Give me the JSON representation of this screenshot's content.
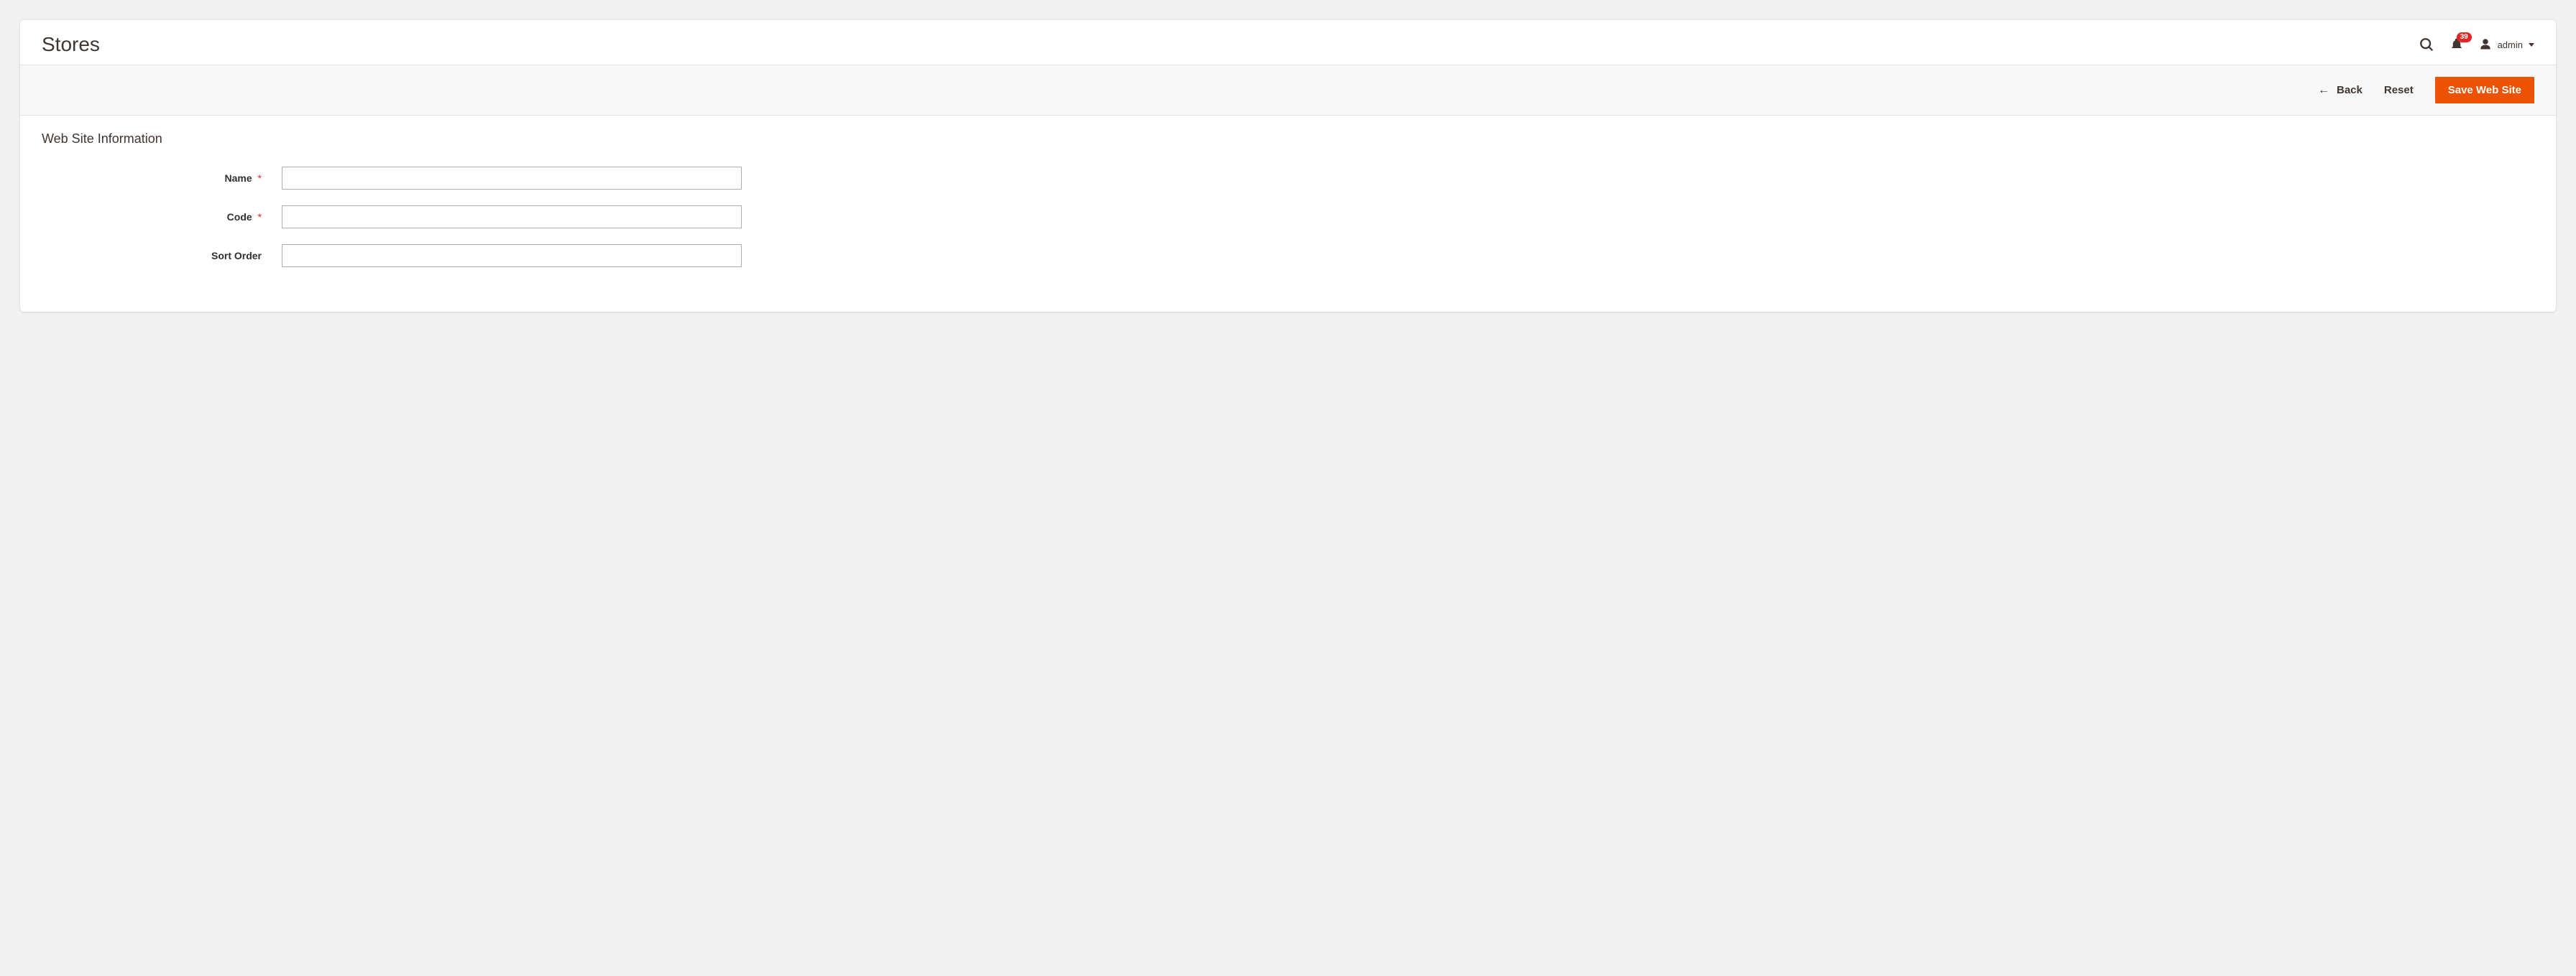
{
  "header": {
    "title": "Stores",
    "notification_count": "39",
    "user_name": "admin"
  },
  "actions": {
    "back": "Back",
    "reset": "Reset",
    "save": "Save Web Site"
  },
  "form": {
    "section_title": "Web Site Information",
    "fields": {
      "name": {
        "label": "Name",
        "required": true,
        "value": ""
      },
      "code": {
        "label": "Code",
        "required": true,
        "value": ""
      },
      "sort_order": {
        "label": "Sort Order",
        "required": false,
        "value": ""
      }
    }
  }
}
